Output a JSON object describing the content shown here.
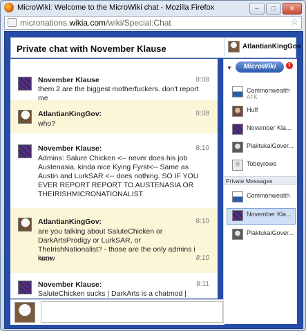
{
  "window": {
    "title": "MicroWiki: Welcome to the MicroWiki chat - Mozilla Firefox",
    "buttons": {
      "minimize": "–",
      "maximize": "□",
      "close": "✕"
    }
  },
  "urlbar": {
    "prefix": "micronations.",
    "domain": "wikia.com",
    "path": "/wiki/Special:Chat"
  },
  "header": {
    "title": "Private chat with November Klause",
    "current_user": "AtlantianKingGov"
  },
  "messages": [
    {
      "user": "November Klause",
      "time": "8:08",
      "text": "them 2 are the biggest motherfuckers. don't report me",
      "avatar": "flag"
    },
    {
      "user": "AtlantianKingGov:",
      "time": "8:08",
      "text": "who?",
      "avatar": "eagle"
    },
    {
      "user": "November Klause:",
      "time": "8:10",
      "text": "Admins: Salure Chicken <-- never does his job Austenasia, kinda nice Kying Fyrst<-- Same as Austin and LurkSAR <-- does nothing. SO IF YOU EVER REPORT REPORT TO AUSTENASIA OR THEIRISHMICRONATIONALIST",
      "avatar": "flag"
    },
    {
      "user": "AtlantianKingGov:",
      "time": "8:10",
      "text": "are you talking about SaluteChicken or DarkArtsProdigy or LurkSAR, or TheIrishNationalist? - those are the only admins i know",
      "extra": "nvm",
      "extra_time": "8:10",
      "avatar": "eagle"
    },
    {
      "user": "November Klause:",
      "time": "8:11",
      "text": "SaluteChicken sucks | DarkArts is a chatmod | Lurksar",
      "avatar": "flag"
    }
  ],
  "sidebar": {
    "wiki_logo": "MicroWiki",
    "wiki_badge": "1",
    "users": [
      {
        "name": "Commonwealth",
        "status": "AFK",
        "icon": "commonwealth-avatar"
      },
      {
        "name": "Huff",
        "status": "",
        "icon": "huff-avatar"
      },
      {
        "name": "November Kla...",
        "status": "",
        "icon": "flag-avatar"
      },
      {
        "name": "PlaktukaiGover...",
        "status": "",
        "icon": "plaktukai-avatar"
      },
      {
        "name": "Tobeyrowe",
        "status": "",
        "icon": "default-avatar"
      }
    ],
    "private_heading": "Private Messages",
    "private": [
      {
        "name": "Commonwealth",
        "icon": "commonwealth-avatar"
      },
      {
        "name": "November Kla...",
        "icon": "flag-avatar"
      },
      {
        "name": "PlaktukaiGover...",
        "icon": "plaktukai-avatar"
      }
    ]
  },
  "colors": {
    "chrome_blue": "#244ca8",
    "alt_message_bg": "#fbf6d8",
    "selected_pm": "#cfe0f6"
  }
}
